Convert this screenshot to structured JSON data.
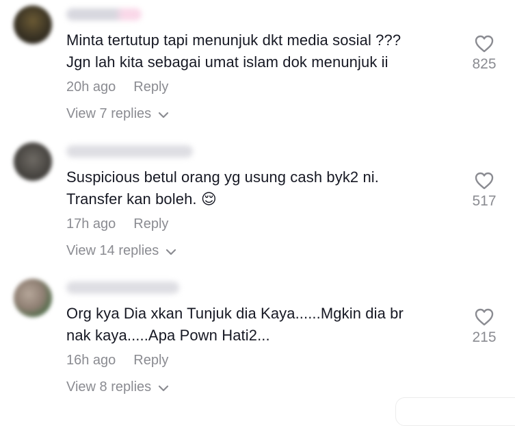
{
  "comments": [
    {
      "username": "",
      "text": "Minta tertutup tapi menunjuk dkt media sosial ???\nJgn lah kita sebagai umat islam dok menunjuk ii",
      "time": "20h ago",
      "reply": "Reply",
      "view_replies": "View 7 replies",
      "likes": "825",
      "avatar_color": "#3a3324"
    },
    {
      "username": "",
      "text": "Suspicious betul orang yg usung cash byk2 ni.\nTransfer kan boleh. 😌",
      "time": "17h ago",
      "reply": "Reply",
      "view_replies": "View 14 replies",
      "likes": "517",
      "avatar_color": "#4a4743"
    },
    {
      "username": "",
      "text": "Org kya Dia xkan Tunjuk dia Kaya......Mgkin dia br\nnak kaya.....Apa Pown Hati2...",
      "time": "16h ago",
      "reply": "Reply",
      "view_replies": "View 8 replies",
      "likes": "215",
      "avatar_color": "#8f7f73"
    }
  ],
  "colors": {
    "text": "#161823",
    "secondary": "#8a8b91"
  },
  "icons": [
    "heart-outline-icon",
    "chevron-down-icon"
  ]
}
